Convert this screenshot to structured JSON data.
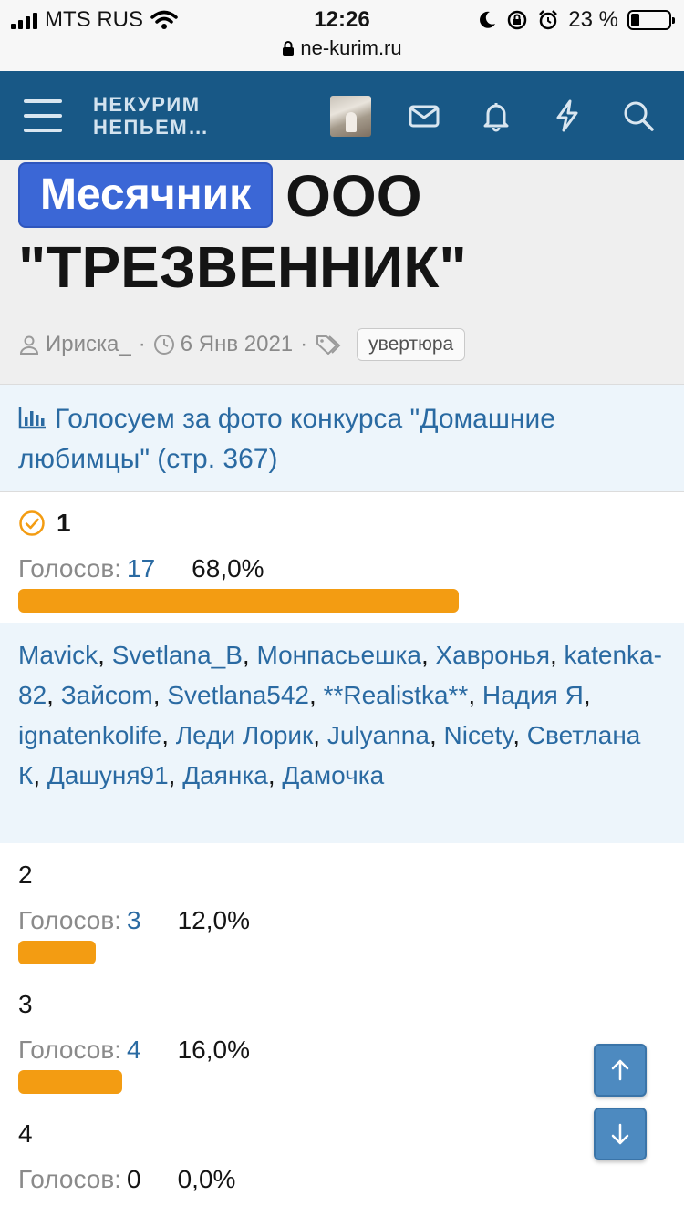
{
  "status_bar": {
    "carrier": "MTS RUS",
    "time": "12:26",
    "battery": "23 %",
    "battery_level": 0.23,
    "url": "ne-kurim.ru"
  },
  "navbar": {
    "logo_line1": "НЕКУРИМ",
    "logo_line2": "НЕПЬЕМ…",
    "icons": [
      "menu-icon",
      "avatar",
      "mail-icon",
      "bell-icon",
      "bolt-icon",
      "search-icon"
    ]
  },
  "thread": {
    "prefix": "Месячник",
    "title": "ООО \"ТРЕЗВЕННИК\"",
    "author": "Ириска_",
    "date": "6 Янв 2021",
    "tag": "увертюра"
  },
  "poll": {
    "title": "Голосуем за фото конкурса \"Домашние любимцы\" (стр. 367)",
    "votes_label": "Голосов:",
    "options": [
      {
        "label": "1",
        "votes": "17",
        "percent": "68,0%",
        "fraction": 0.68,
        "voted": true
      },
      {
        "label": "2",
        "votes": "3",
        "percent": "12,0%",
        "fraction": 0.12,
        "voted": false
      },
      {
        "label": "3",
        "votes": "4",
        "percent": "16,0%",
        "fraction": 0.16,
        "voted": false
      },
      {
        "label": "4",
        "votes": "0",
        "percent": "0,0%",
        "fraction": 0.0,
        "voted": false
      }
    ],
    "voters": [
      "Mavick",
      "Svetlana_B",
      "Монпасьешка",
      "Хавронья",
      "katenka-82",
      "Зайcom",
      "Svetlana542",
      "**Realistka**",
      "Надия Я",
      "ignatenkolife",
      "Леди Лорик",
      "Julyanna",
      "Nicety",
      "Светлана К",
      "Дашуня91",
      "Даянка",
      "Дамочка"
    ]
  },
  "colors": {
    "navbar": "#185886",
    "prefix_badge": "#3b67d6",
    "link": "#2a6aa2",
    "bar": "#f39c12",
    "poll_bg": "#edf5fb"
  }
}
